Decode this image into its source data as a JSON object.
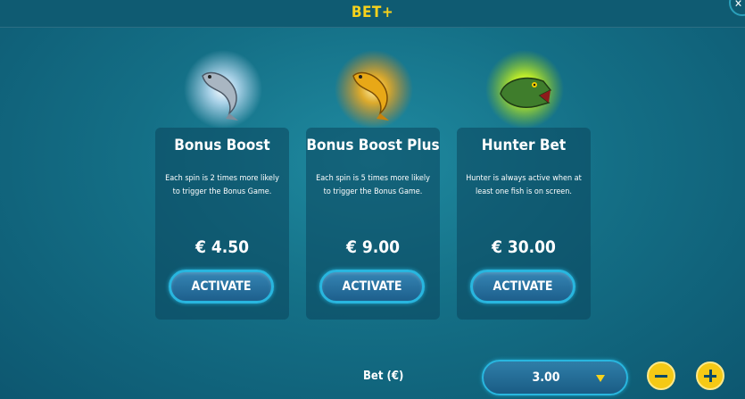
{
  "header": {
    "title": "BET+"
  },
  "cards": [
    {
      "title": "Bonus Boost",
      "description": "Each spin is 2 times more likely to trigger the Bonus Game.",
      "price": "€ 4.50",
      "button": "ACTIVATE",
      "icon": "silver-fish-icon",
      "glow": "#cfe9ff"
    },
    {
      "title": "Bonus Boost Plus",
      "description": "Each spin is 5 times more likely to trigger the Bonus Game.",
      "price": "€ 9.00",
      "button": "ACTIVATE",
      "icon": "gold-fish-icon",
      "glow": "#ffb21a"
    },
    {
      "title": "Hunter Bet",
      "description": "Hunter is always active when at least one fish is on screen.",
      "price": "€ 30.00",
      "button": "ACTIVATE",
      "icon": "pike-fish-icon",
      "glow": "#d8ff1a"
    }
  ],
  "bet": {
    "label": "Bet (€)",
    "value": "3.00"
  },
  "colors": {
    "accent": "#f7d21c",
    "button_border": "#28b6df",
    "background": "#146f86"
  }
}
